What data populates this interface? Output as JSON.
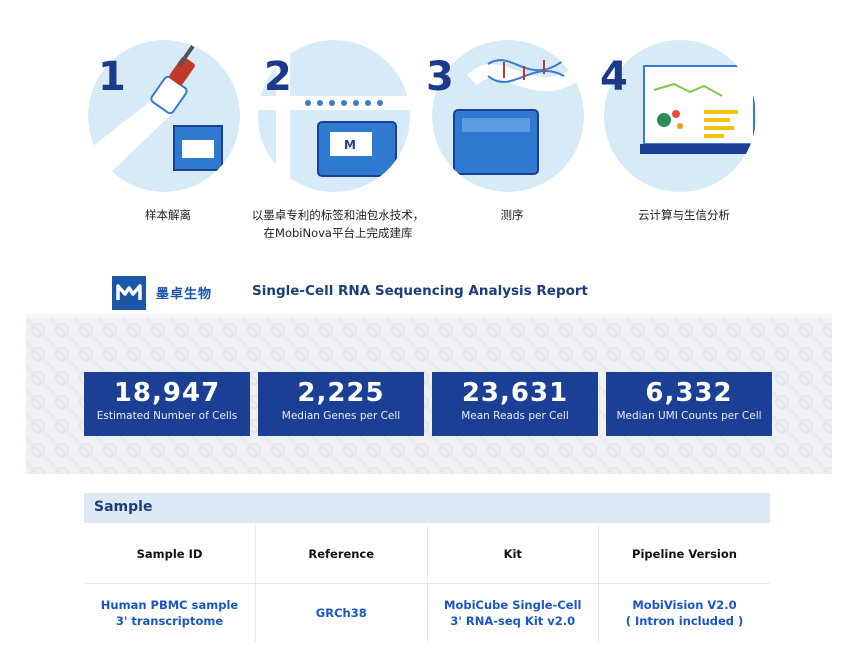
{
  "steps": [
    {
      "number": "1",
      "caption": "样本解离"
    },
    {
      "number": "2",
      "caption": "以墨卓专利的标签和油包水技术，\n在MobiNova平台上完成建库"
    },
    {
      "number": "3",
      "caption": "测序"
    },
    {
      "number": "4",
      "caption": "云计算与生信分析"
    }
  ],
  "header": {
    "brand": "墨卓生物",
    "title": "Single-Cell RNA Sequencing Analysis Report"
  },
  "stats": [
    {
      "value": "18,947",
      "label": "Estimated Number of Cells"
    },
    {
      "value": "2,225",
      "label": "Median Genes per Cell"
    },
    {
      "value": "23,631",
      "label": "Mean Reads per Cell"
    },
    {
      "value": "6,332",
      "label": "Median UMI Counts per Cell"
    }
  ],
  "sample": {
    "title": "Sample",
    "columns": [
      "Sample ID",
      "Reference",
      "Kit",
      "Pipeline Version"
    ],
    "row": [
      "Human PBMC sample\n3' transcriptome",
      "GRCh38",
      "MobiCube Single-Cell\n3' RNA-seq Kit v2.0",
      "MobiVision V2.0\n( Intron included )"
    ]
  },
  "colors": {
    "accent": "#1b3f94",
    "circle": "#d6eaf8",
    "link": "#1b56c4"
  }
}
